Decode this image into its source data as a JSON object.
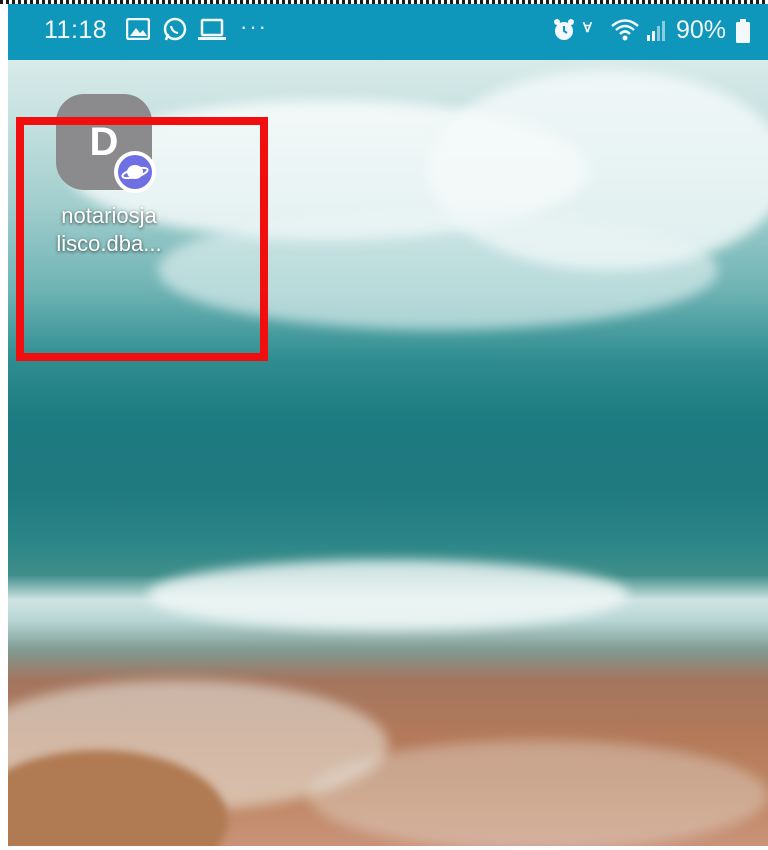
{
  "status_bar": {
    "time": "11:18",
    "more_glyph": "···",
    "volte": "Ɐ",
    "battery_percent": "90%",
    "icons": [
      "gallery-icon",
      "whatsapp-icon",
      "laptop-icon",
      "more-icon",
      "alarm-icon",
      "volte-icon",
      "wifi-icon",
      "signal-icon",
      "battery-icon"
    ],
    "background_color": "#0e96bb"
  },
  "home_screen": {
    "shortcut": {
      "icon_letter": "D",
      "label_line1": "notariosja",
      "label_line2": "lisco.dba...",
      "icon_color": "#8b8b8d",
      "badge_icon": "samsung-internet-icon",
      "badge_color": "#6d6fe3"
    }
  },
  "highlight": {
    "color": "#f00e0e"
  }
}
